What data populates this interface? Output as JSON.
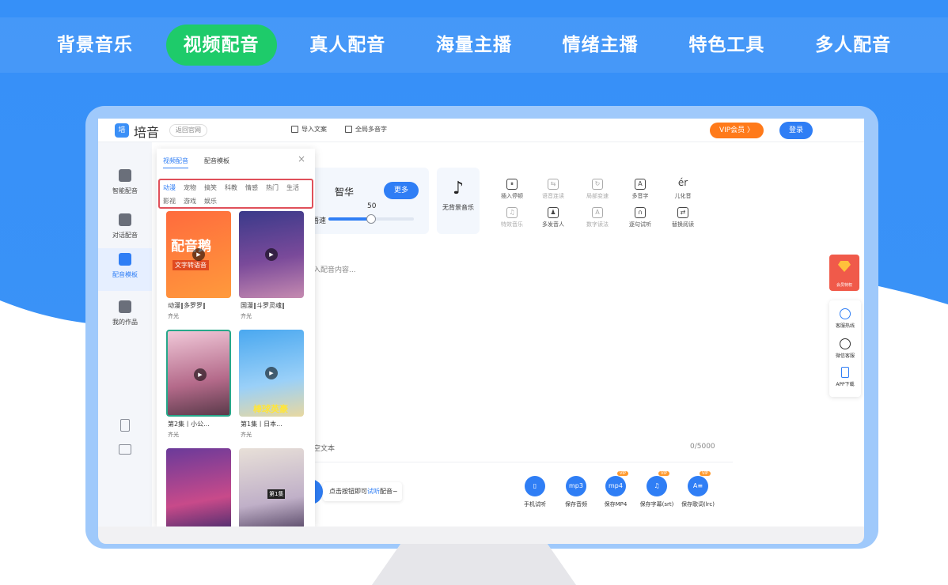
{
  "top_tabs": [
    "背景音乐",
    "视频配音",
    "真人配音",
    "海量主播",
    "情绪主播",
    "特色工具",
    "多人配音"
  ],
  "header": {
    "logo_mark": "培",
    "logo_text": "培音",
    "back_link": "返回官网",
    "import_text": "导入文案",
    "polyphonic": "全局多音字",
    "vip": "VIP会员 〉",
    "login": "登录"
  },
  "left_rail": [
    "智能配音",
    "对话配音",
    "配音模板",
    "我的作品"
  ],
  "panel": {
    "tabs": [
      "视频配音",
      "配音模板"
    ],
    "close": "×",
    "categories_row1": [
      "动漫",
      "宠物",
      "搞笑",
      "科教",
      "情感",
      "热门",
      "生活"
    ],
    "categories_row2": [
      "影视",
      "游戏",
      "娱乐"
    ],
    "cards": [
      {
        "title": "动漫‖多罗罗‖",
        "author": "齐光",
        "thumb_text": "配音鹅",
        "thumb_sub": "文字转语音"
      },
      {
        "title": "国漫‖斗罗灵魂‖",
        "author": "齐光",
        "thumb_text": "",
        "thumb_sub": ""
      },
      {
        "title": "第2集丨小公...",
        "author": "齐光",
        "thumb_text": "",
        "thumb_sub": ""
      },
      {
        "title": "第1集丨日本...",
        "author": "齐光",
        "thumb_text": "棒球英豪",
        "thumb_sub": ""
      },
      {
        "title": "",
        "author": "",
        "thumb_text": "",
        "thumb_sub": ""
      },
      {
        "title": "",
        "author": "",
        "thumb_text": "第1集",
        "thumb_sub": ""
      }
    ]
  },
  "voice": {
    "name": "智华",
    "more": "更多",
    "speed_label": "语速",
    "speed_value": "50",
    "speed_fraction": 0.5
  },
  "bgm": {
    "icon": "♪",
    "label": "无背景音乐"
  },
  "tools_row1": [
    {
      "label": "插入停顿",
      "glyph": "⏸"
    },
    {
      "label": "语音连读",
      "glyph": "⇆"
    },
    {
      "label": "局部变速",
      "glyph": "↻"
    },
    {
      "label": "多音字",
      "glyph": "A"
    },
    {
      "label": "儿化音",
      "glyph": "ér"
    }
  ],
  "tools_row2": [
    {
      "label": "特效音乐",
      "glyph": "♫"
    },
    {
      "label": "多发音人",
      "glyph": "♟"
    },
    {
      "label": "数字读法",
      "glyph": "A"
    },
    {
      "label": "逐句试听",
      "glyph": "∩"
    },
    {
      "label": "替换阅读",
      "glyph": "⇄"
    }
  ],
  "editor": {
    "placeholder": "入配音内容...",
    "clear": "空文本",
    "counter": "0/5000"
  },
  "bottom": {
    "tip_prefix": "点击按钮即可",
    "tip_highlight": "试听",
    "tip_suffix": "配音~",
    "actions": [
      {
        "label": "手机试听",
        "glyph": "▯",
        "vip": ""
      },
      {
        "label": "保存音频",
        "glyph": "mp3",
        "vip": ""
      },
      {
        "label": "保存MP4",
        "glyph": "mp4",
        "vip": "VIP"
      },
      {
        "label": "保存字幕(srt)",
        "glyph": "♫",
        "vip": "VIP"
      },
      {
        "label": "保存歌词(lrc)",
        "glyph": "A≡",
        "vip": "VIP"
      }
    ]
  },
  "side_float": {
    "label": "会员特权"
  },
  "side_panel": [
    "客服热线",
    "微信客服",
    "APP下载"
  ],
  "colors": {
    "primary": "#2f7ef5",
    "green": "#1ecb6a",
    "vip": "#ff7a1a",
    "highlight_box": "#e0505a"
  }
}
